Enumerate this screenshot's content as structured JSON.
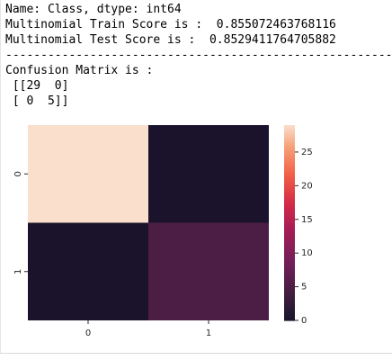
{
  "output": {
    "lines": [
      "Name: Class, dtype: int64",
      "Multinomial Train Score is :  0.855072463768116",
      "Multinomial Test Score is :  0.8529411764705882",
      "-------------------------------------------------------",
      "Confusion Matrix is :",
      " [[29  0]",
      " [ 0  5]]"
    ]
  },
  "chart_data": {
    "type": "heatmap",
    "matrix": [
      [
        29,
        0
      ],
      [
        0,
        5
      ]
    ],
    "x_ticks": [
      "0",
      "1"
    ],
    "y_ticks": [
      "0",
      "1"
    ],
    "title": "",
    "xlabel": "",
    "ylabel": "",
    "colorbar": {
      "range": [
        0,
        29
      ],
      "ticks": [
        0,
        5,
        10,
        15,
        20,
        25
      ]
    },
    "colormap": "rocket",
    "grid": false
  }
}
